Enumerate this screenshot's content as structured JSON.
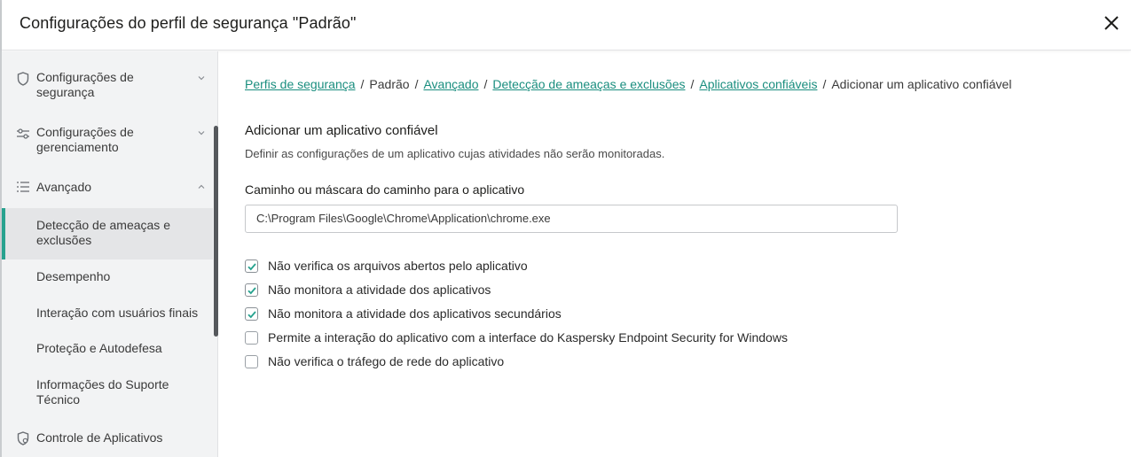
{
  "header": {
    "title": "Configurações do perfil de segurança \"Padrão\""
  },
  "sidebar": {
    "items": [
      {
        "label_line1": "Configurações de",
        "label_line2": "segurança",
        "icon": "shield-icon",
        "expanded": false
      },
      {
        "label_line1": "Configurações de",
        "label_line2": "gerenciamento",
        "icon": "sliders-icon",
        "expanded": false
      },
      {
        "label": "Avançado",
        "icon": "list-icon",
        "expanded": true
      },
      {
        "label_line1": "Detecção de ameaças e",
        "label_line2": "exclusões",
        "selected": true
      },
      {
        "label": "Desempenho"
      },
      {
        "label": "Interação com usuários finais"
      },
      {
        "label": "Proteção e Autodefesa"
      },
      {
        "label_line1": "Informações do Suporte",
        "label_line2": "Técnico"
      },
      {
        "label": "Controle de Aplicativos",
        "icon": "app-control-icon"
      }
    ]
  },
  "breadcrumb": {
    "items": [
      {
        "label": "Perfis de segurança",
        "link": true
      },
      {
        "label": "Padrão",
        "link": false
      },
      {
        "label": "Avançado",
        "link": true
      },
      {
        "label": "Detecção de ameaças e exclusões",
        "link": true
      },
      {
        "label": "Aplicativos confiáveis",
        "link": true
      },
      {
        "label": "Adicionar um aplicativo confiável",
        "link": false
      }
    ],
    "separator": "/"
  },
  "main": {
    "section_title": "Adicionar um aplicativo confiável",
    "section_desc": "Definir as configurações de um aplicativo cujas atividades não serão monitoradas.",
    "path_label": "Caminho ou máscara do caminho para o aplicativo",
    "path_value": "C:\\Program Files\\Google\\Chrome\\Application\\chrome.exe",
    "options": [
      {
        "label": "Não verifica os arquivos abertos pelo aplicativo",
        "checked": true
      },
      {
        "label": "Não monitora a atividade dos aplicativos",
        "checked": true
      },
      {
        "label": "Não monitora a atividade dos aplicativos secundários",
        "checked": true
      },
      {
        "label": "Permite a interação do aplicativo com a interface do Kaspersky Endpoint Security for Windows",
        "checked": false
      },
      {
        "label": "Não verifica o tráfego de rede do aplicativo",
        "checked": false
      }
    ]
  },
  "colors": {
    "accent": "#27a28f",
    "link": "#1a8e7f",
    "sidebar_bg": "#f2f3f4",
    "selected_bg": "#e4e5e7"
  }
}
